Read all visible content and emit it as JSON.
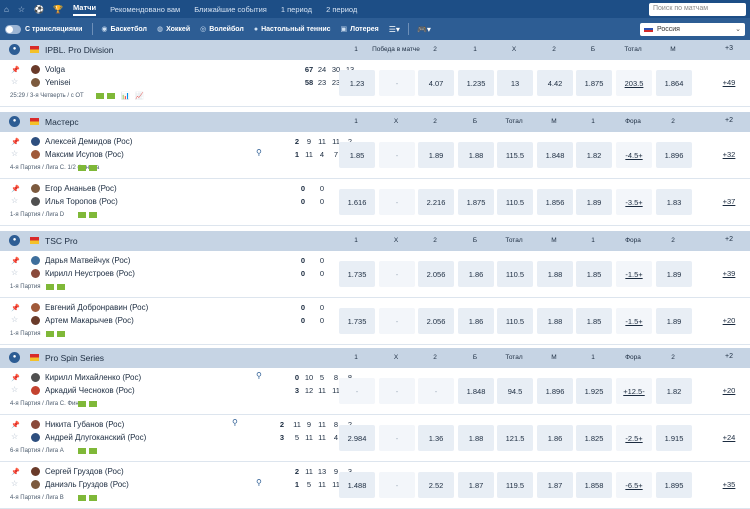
{
  "nav": {
    "tabs": [
      "Матчи",
      "Рекомендовано вам",
      "Ближайшие события",
      "1 период",
      "2 период"
    ],
    "search_placeholder": "Поиск по матчам"
  },
  "filters": {
    "broadcast": "С трансляциями",
    "sports": [
      "Баскетбол",
      "Хоккей",
      "Волейбол",
      "Настольный теннис",
      "Лотерея"
    ],
    "region": "Россия"
  },
  "leagues": [
    {
      "name": "IPBL. Pro Division",
      "cols": [
        "1",
        "Победа в матче",
        "2",
        "1",
        "X",
        "2",
        "Б",
        "Тотал",
        "М"
      ],
      "more": "+3",
      "events": [
        {
          "p1": "Volga",
          "p2": "Yenisei",
          "s1": [
            "67",
            "24",
            "30",
            "13"
          ],
          "s2": [
            "58",
            "23",
            "23",
            "12"
          ],
          "status": "25:29 / 3-я Четверть / с ОТ",
          "odds": [
            "1.23",
            "-",
            "4.07",
            "1.235",
            "13",
            "4.42",
            "1.875",
            "203.5",
            "1.864"
          ],
          "more": "+49"
        }
      ]
    },
    {
      "name": "Мастерс",
      "cols": [
        "1",
        "X",
        "2",
        "Б",
        "Тотал",
        "М",
        "1",
        "Фора",
        "2"
      ],
      "more": "+2",
      "events": [
        {
          "p1": "Алексей Демидов (Рос)",
          "p2": "Максим Исупов (Рос)",
          "s1": [
            "2",
            "9",
            "11",
            "11",
            "2"
          ],
          "s2": [
            "1",
            "11",
            "4",
            "7",
            "4"
          ],
          "status": "4-я Партия / Лига С. 1/2 финала",
          "odds": [
            "1.85",
            "-",
            "1.89",
            "1.88",
            "115.5",
            "1.848",
            "1.82",
            "-4.5+",
            "1.896"
          ],
          "more": "+32"
        },
        {
          "p1": "Егор Ананьев (Рос)",
          "p2": "Илья Торопов (Рос)",
          "s1": [
            "0",
            "0"
          ],
          "s2": [
            "0",
            "0"
          ],
          "status": "1-я Партия / Лига D",
          "odds": [
            "1.616",
            "-",
            "2.216",
            "1.875",
            "110.5",
            "1.856",
            "1.89",
            "-3.5+",
            "1.83"
          ],
          "more": "+37"
        }
      ]
    },
    {
      "name": "TSC Pro",
      "cols": [
        "1",
        "X",
        "2",
        "Б",
        "Тотал",
        "М",
        "1",
        "Фора",
        "2"
      ],
      "more": "+2",
      "events": [
        {
          "p1": "Дарья Матвейчук (Рос)",
          "p2": "Кирилл Неустроев (Рос)",
          "s1": [
            "0",
            "0"
          ],
          "s2": [
            "0",
            "0"
          ],
          "status": "1-я Партия",
          "odds": [
            "1.735",
            "-",
            "2.056",
            "1.86",
            "110.5",
            "1.88",
            "1.85",
            "-1.5+",
            "1.89"
          ],
          "more": "+39"
        },
        {
          "p1": "Евгений Добронравин (Рос)",
          "p2": "Артем Макарычев (Рос)",
          "s1": [
            "0",
            "0"
          ],
          "s2": [
            "0",
            "0"
          ],
          "status": "1-я Партия",
          "odds": [
            "1.735",
            "-",
            "2.056",
            "1.86",
            "110.5",
            "1.88",
            "1.85",
            "-1.5+",
            "1.89"
          ],
          "more": "+20"
        }
      ]
    },
    {
      "name": "Pro Spin Series",
      "cols": [
        "1",
        "X",
        "2",
        "Б",
        "Тотал",
        "М",
        "1",
        "Фора",
        "2"
      ],
      "more": "+2",
      "events": [
        {
          "p1": "Кирилл Михайленко (Рос)",
          "p2": "Аркадий Чесноков (Рос)",
          "s1": [
            "0",
            "10",
            "5",
            "8",
            "8"
          ],
          "s2": [
            "3",
            "12",
            "11",
            "11",
            "7"
          ],
          "status": "4-я Партия / Лига С. Финал",
          "odds": [
            "-",
            "-",
            "-",
            "1.848",
            "94.5",
            "1.896",
            "1.925",
            "+12.5-",
            "1.82"
          ],
          "more": "+20"
        },
        {
          "p1": "Никита Губанов (Рос)",
          "p2": "Андрей Длугоканский (Рос)",
          "s1": [
            "2",
            "11",
            "9",
            "11",
            "8",
            "2"
          ],
          "s2": [
            "3",
            "5",
            "11",
            "11",
            "4",
            "11"
          ],
          "status": "6-я Партия / Лига А",
          "odds": [
            "2.984",
            "-",
            "1.36",
            "1.88",
            "121.5",
            "1.86",
            "1.825",
            "-2.5+",
            "1.915"
          ],
          "more": "+24"
        },
        {
          "p1": "Сергей Груздов (Рос)",
          "p2": "Даниэль Груздов (Рос)",
          "s1": [
            "2",
            "11",
            "13",
            "9",
            "3"
          ],
          "s2": [
            "1",
            "5",
            "11",
            "11",
            "5"
          ],
          "status": "4-я Партия / Лига В",
          "odds": [
            "1.488",
            "-",
            "2.52",
            "1.87",
            "119.5",
            "1.87",
            "1.858",
            "-6.5+",
            "1.895"
          ],
          "more": "+35"
        }
      ]
    }
  ]
}
